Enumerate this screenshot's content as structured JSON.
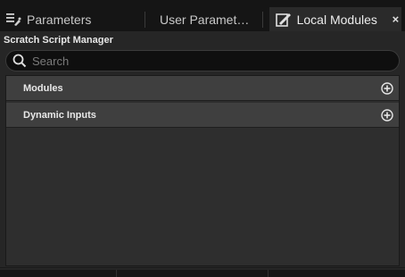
{
  "tabs": [
    {
      "label": "Parameters",
      "icon": "parameters-icon",
      "active": false
    },
    {
      "label": "User Paramet…",
      "icon": null,
      "active": false
    },
    {
      "label": "Local Modules",
      "icon": "local-modules-icon",
      "active": true
    }
  ],
  "close_label": "×",
  "panel": {
    "title": "Scratch Script Manager",
    "search_placeholder": "Search",
    "sections": [
      {
        "label": "Modules",
        "action_icon": "add-circle-icon"
      },
      {
        "label": "Dynamic Inputs",
        "action_icon": "add-circle-icon"
      }
    ]
  },
  "colors": {
    "background": "#151515",
    "panel": "#262626",
    "section_header": "#3f3f3f",
    "active_tab": "#2a2a2a",
    "text": "#d8d8d8"
  }
}
